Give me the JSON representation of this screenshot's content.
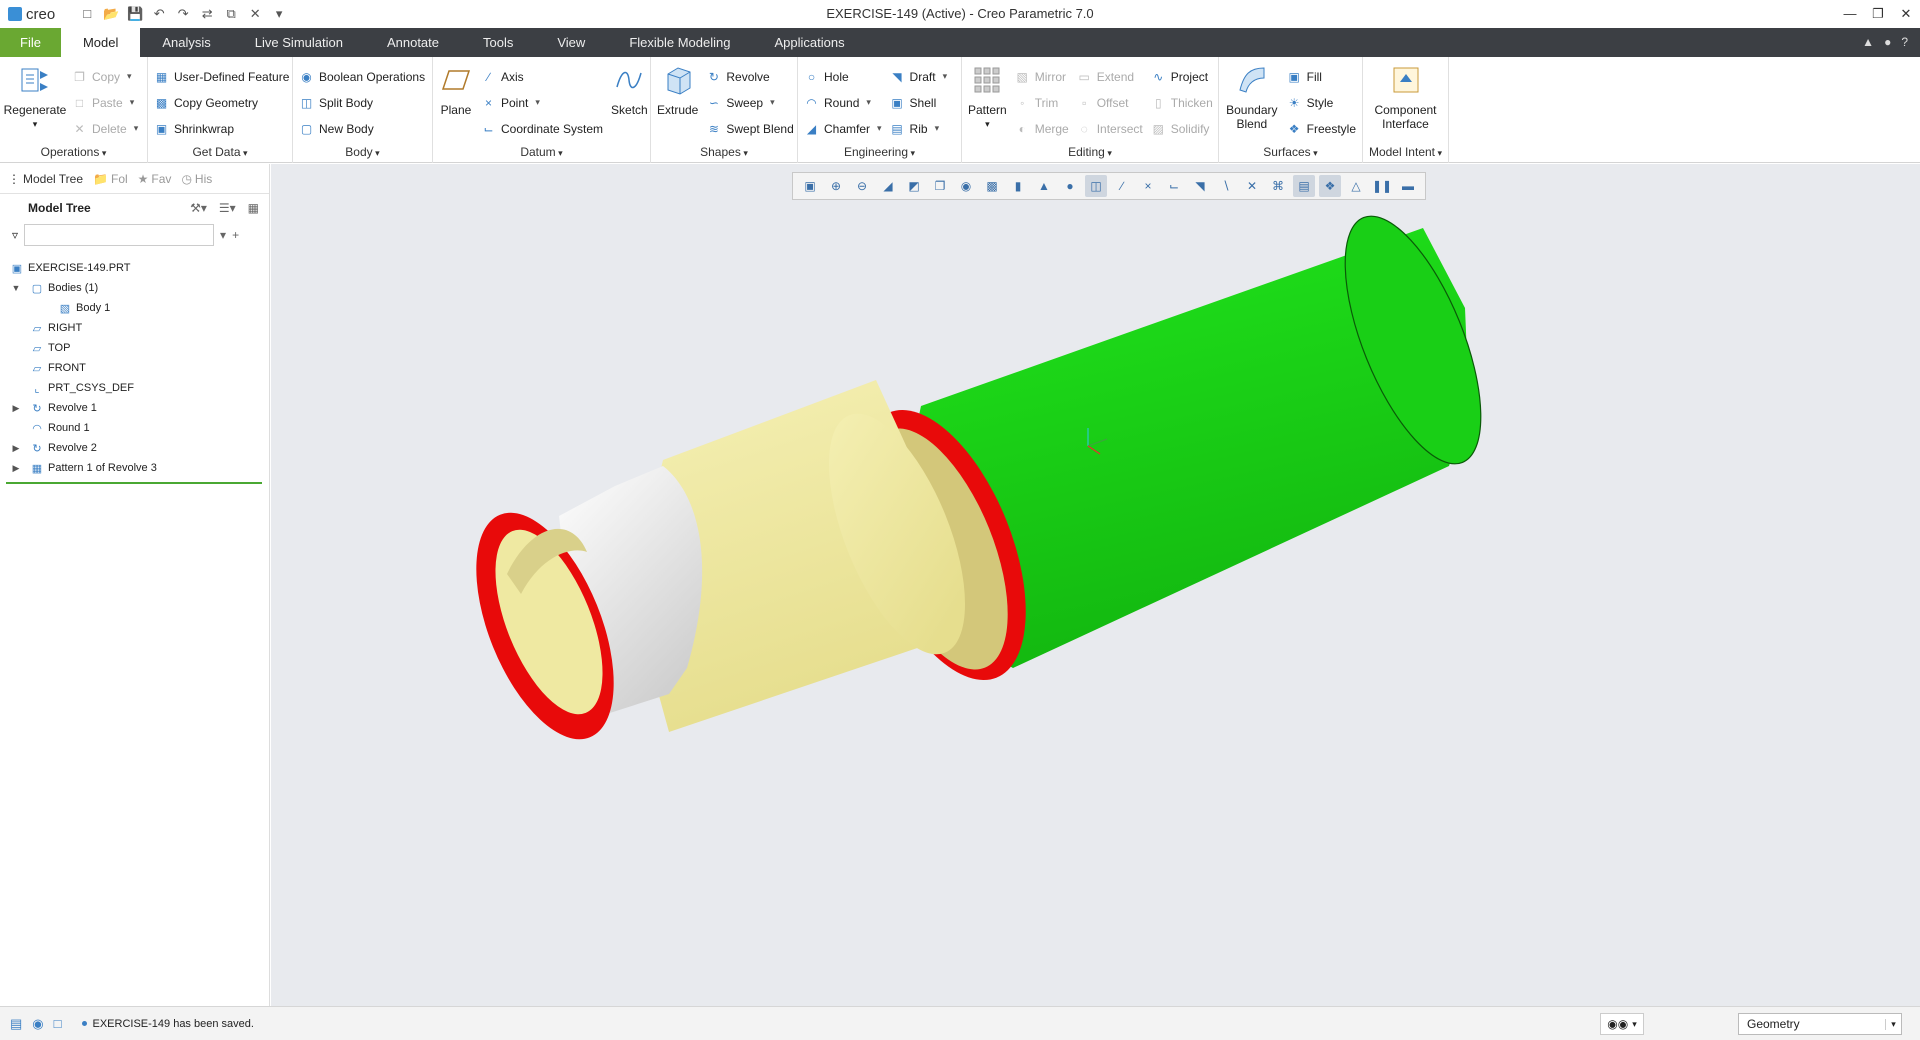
{
  "app": {
    "logo_text": "creo",
    "window_title": "EXERCISE-149 (Active) - Creo Parametric 7.0"
  },
  "tabs": [
    {
      "label": "File"
    },
    {
      "label": "Model"
    },
    {
      "label": "Analysis"
    },
    {
      "label": "Live Simulation"
    },
    {
      "label": "Annotate"
    },
    {
      "label": "Tools"
    },
    {
      "label": "View"
    },
    {
      "label": "Flexible Modeling"
    },
    {
      "label": "Applications"
    }
  ],
  "ribbon": {
    "operations": {
      "label": "Operations",
      "regenerate": "Regenerate",
      "copy": "Copy",
      "paste": "Paste",
      "delete": "Delete"
    },
    "get_data": {
      "label": "Get Data",
      "udf": "User-Defined Feature",
      "copy_geometry": "Copy Geometry",
      "shrinkwrap": "Shrinkwrap"
    },
    "body": {
      "label": "Body",
      "boolean": "Boolean Operations",
      "split": "Split Body",
      "new": "New Body"
    },
    "datum": {
      "label": "Datum",
      "plane": "Plane",
      "axis": "Axis",
      "point": "Point",
      "csys": "Coordinate System",
      "sketch": "Sketch"
    },
    "shapes": {
      "label": "Shapes",
      "extrude": "Extrude",
      "revolve": "Revolve",
      "sweep": "Sweep",
      "swept_blend": "Swept Blend"
    },
    "engineering": {
      "label": "Engineering",
      "hole": "Hole",
      "round": "Round",
      "chamfer": "Chamfer",
      "draft": "Draft",
      "shell": "Shell",
      "rib": "Rib"
    },
    "editing": {
      "label": "Editing",
      "pattern": "Pattern",
      "mirror": "Mirror",
      "trim": "Trim",
      "merge": "Merge",
      "extend": "Extend",
      "offset": "Offset",
      "intersect": "Intersect",
      "project": "Project",
      "thicken": "Thicken",
      "solidify": "Solidify"
    },
    "surfaces": {
      "label": "Surfaces",
      "boundary_blend_1": "Boundary",
      "boundary_blend_2": "Blend",
      "fill": "Fill",
      "style": "Style",
      "freestyle": "Freestyle"
    },
    "model_intent": {
      "label": "Model Intent",
      "component_1": "Component",
      "component_2": "Interface"
    }
  },
  "panel": {
    "tabs": [
      "Model Tree",
      "Fol",
      "Fav",
      "His"
    ],
    "header": "Model Tree",
    "search_value": ""
  },
  "tree": [
    {
      "label": "EXERCISE-149.PRT",
      "icon": "part-icon",
      "indent": 0,
      "toggle": ""
    },
    {
      "label": "Bodies (1)",
      "icon": "bodies-icon",
      "indent": 1,
      "toggle": "▼"
    },
    {
      "label": "Body 1",
      "icon": "body-icon",
      "indent": 2,
      "toggle": ""
    },
    {
      "label": "RIGHT",
      "icon": "datum-plane-icon",
      "indent": 1,
      "toggle": ""
    },
    {
      "label": "TOP",
      "icon": "datum-plane-icon",
      "indent": 1,
      "toggle": ""
    },
    {
      "label": "FRONT",
      "icon": "datum-plane-icon",
      "indent": 1,
      "toggle": ""
    },
    {
      "label": "PRT_CSYS_DEF",
      "icon": "csys-icon",
      "indent": 1,
      "toggle": ""
    },
    {
      "label": "Revolve 1",
      "icon": "revolve-icon",
      "indent": 1,
      "toggle": "▶"
    },
    {
      "label": "Round 1",
      "icon": "round-icon",
      "indent": 1,
      "toggle": ""
    },
    {
      "label": "Revolve 2",
      "icon": "revolve-icon",
      "indent": 1,
      "toggle": "▶"
    },
    {
      "label": "Pattern 1 of Revolve 3",
      "icon": "pattern-icon",
      "indent": 1,
      "toggle": "▶"
    }
  ],
  "status": {
    "message": "EXERCISE-149 has been saved.",
    "filter_value": "Geometry"
  },
  "colors": {
    "file_tab": "#6aa832",
    "tab_bar": "#3c3f44",
    "viewport_bg": "#e8eaee",
    "model_green": "#1ed41a",
    "model_red": "#e80a0a",
    "model_yellow": "#efe9a2",
    "model_white": "#f2f2f2"
  }
}
